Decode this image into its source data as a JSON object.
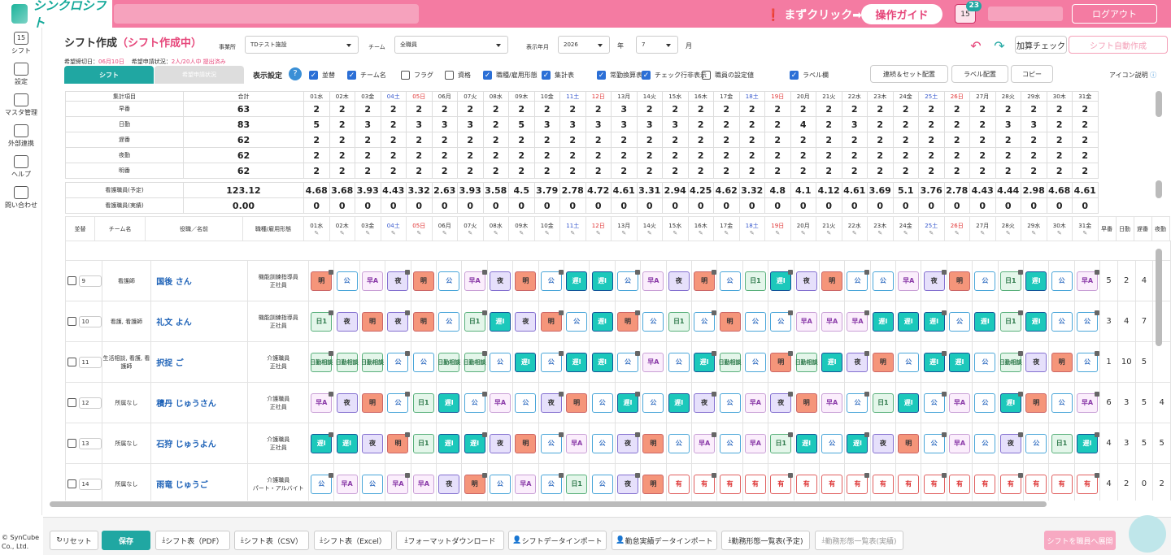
{
  "app": {
    "logo": "シンクロシフト",
    "first_click": "まずクリック➡",
    "guide": "操作ガイド",
    "cal_num": "15",
    "badge": "23",
    "logout": "ログアウト"
  },
  "sidebar": [
    {
      "label": "シフト",
      "icon": "calendar-icon"
    },
    {
      "label": "設定",
      "icon": "gear-icon"
    },
    {
      "label": "マスタ管理",
      "icon": "database-icon"
    },
    {
      "label": "外部連携",
      "icon": "cloud-icon"
    },
    {
      "label": "ヘルプ",
      "icon": "help-icon"
    },
    {
      "label": "問い合わせ",
      "icon": "mail-icon"
    }
  ],
  "copyright": "© SynCube Co., Ltd.",
  "page": {
    "title": "シフト作成",
    "status": "（シフト作成中）",
    "facility_lbl": "事業所",
    "facility": "TDテスト施設",
    "team_lbl": "チーム",
    "team": "全職員",
    "ym_lbl": "表示年月",
    "year": "2026",
    "year_unit": "年",
    "month": "7",
    "month_unit": "月",
    "deadline": "希望締切日：",
    "deadline_val": "06月10日",
    "req_status": "希望申請状況：",
    "req_val": "2人/20人中 提出済み",
    "btn_add": "加算チェック",
    "btn_auto": "シフト自動作成",
    "tab_shift": "シフト",
    "tab_req": "希望申請状況",
    "disp": "表示設定",
    "btn_chain": "連続＆セット配置",
    "btn_label": "ラベル配置",
    "btn_copy": "コピー",
    "icon_help": "アイコン説明"
  },
  "checks": [
    {
      "l": "並替",
      "on": true
    },
    {
      "l": "チーム名",
      "on": true
    },
    {
      "l": "フラグ",
      "on": false
    },
    {
      "l": "資格",
      "on": false
    },
    {
      "l": "職種/雇用形態",
      "on": true
    },
    {
      "l": "集計表",
      "on": true
    },
    {
      "l": "常勤換算表",
      "on": true
    },
    {
      "l": "チェック行非表示",
      "on": true
    },
    {
      "l": "職員の設定値",
      "on": false
    },
    {
      "l": "ラベル欄",
      "on": true
    }
  ],
  "days": [
    "01水",
    "02木",
    "03金",
    "04土",
    "05日",
    "06月",
    "07火",
    "08水",
    "09木",
    "10金",
    "11土",
    "12日",
    "13月",
    "14火",
    "15水",
    "16木",
    "17金",
    "18土",
    "19日",
    "20月",
    "21火",
    "22水",
    "23木",
    "24金",
    "25土",
    "26日",
    "27月",
    "28火",
    "29水",
    "30木",
    "31金"
  ],
  "summary": {
    "h1": "集計項目",
    "h2": "合計",
    "rows": [
      {
        "name": "早番",
        "total": "63",
        "v": [
          "2",
          "2",
          "2",
          "2",
          "2",
          "2",
          "2",
          "2",
          "2",
          "2",
          "2",
          "2",
          "3",
          "2",
          "2",
          "2",
          "2",
          "2",
          "2",
          "2",
          "2",
          "2",
          "2",
          "2",
          "2",
          "2",
          "2",
          "2",
          "2",
          "2",
          "2"
        ]
      },
      {
        "name": "日勤",
        "total": "83",
        "v": [
          "5",
          "2",
          "3",
          "2",
          "3",
          "3",
          "3",
          "2",
          "5",
          "3",
          "3",
          "3",
          "3",
          "3",
          "3",
          "2",
          "2",
          "2",
          "2",
          "4",
          "2",
          "3",
          "2",
          "2",
          "2",
          "2",
          "2",
          "3",
          "3",
          "2",
          "2"
        ]
      },
      {
        "name": "遅番",
        "total": "62",
        "v": [
          "2",
          "2",
          "2",
          "2",
          "2",
          "2",
          "2",
          "2",
          "2",
          "2",
          "2",
          "2",
          "2",
          "2",
          "2",
          "2",
          "2",
          "2",
          "2",
          "2",
          "2",
          "2",
          "2",
          "2",
          "2",
          "2",
          "2",
          "2",
          "2",
          "2",
          "2"
        ]
      },
      {
        "name": "夜勤",
        "total": "62",
        "v": [
          "2",
          "2",
          "2",
          "2",
          "2",
          "2",
          "2",
          "2",
          "2",
          "2",
          "2",
          "2",
          "2",
          "2",
          "2",
          "2",
          "2",
          "2",
          "2",
          "2",
          "2",
          "2",
          "2",
          "2",
          "2",
          "2",
          "2",
          "2",
          "2",
          "2",
          "2"
        ]
      },
      {
        "name": "明番",
        "total": "62",
        "v": [
          "2",
          "2",
          "2",
          "2",
          "2",
          "2",
          "2",
          "2",
          "2",
          "2",
          "2",
          "2",
          "2",
          "2",
          "2",
          "2",
          "2",
          "2",
          "2",
          "2",
          "2",
          "2",
          "2",
          "2",
          "2",
          "2",
          "2",
          "2",
          "2",
          "2",
          "2"
        ]
      }
    ],
    "fte": [
      {
        "name": "看護職員(予定)",
        "total": "123.12",
        "v": [
          "4.68",
          "3.68",
          "3.93",
          "4.43",
          "3.32",
          "2.63",
          "3.93",
          "3.58",
          "4.5",
          "3.79",
          "2.78",
          "4.72",
          "4.61",
          "3.31",
          "2.94",
          "4.25",
          "4.62",
          "3.32",
          "4.8",
          "4.1",
          "4.12",
          "4.61",
          "3.69",
          "5.1",
          "3.76",
          "2.78",
          "4.43",
          "4.44",
          "2.98",
          "4.68",
          "4.61"
        ]
      },
      {
        "name": "看護職員(実績)",
        "total": "0.00",
        "v": [
          "0",
          "0",
          "0",
          "0",
          "0",
          "0",
          "0",
          "0",
          "0",
          "0",
          "0",
          "0",
          "0",
          "0",
          "0",
          "0",
          "0",
          "0",
          "0",
          "0",
          "0",
          "0",
          "0",
          "0",
          "0",
          "0",
          "0",
          "0",
          "0",
          "0",
          "0"
        ]
      }
    ]
  },
  "grid_headers": {
    "sort": "並替",
    "team": "チーム名",
    "name": "役職／名前",
    "job": "職種/雇用形態",
    "tot": [
      "早番",
      "日勤",
      "遅番",
      "夜勤"
    ]
  },
  "staff": [
    {
      "no": "9",
      "team": "看護師",
      "name": "国後 さん",
      "job": "機能訓練指導員",
      "emp": "正社員",
      "s": [
        "明",
        "公",
        "早A",
        "夜",
        "明",
        "公",
        "早A",
        "夜",
        "明",
        "公",
        "遅I",
        "遅I",
        "公",
        "早A",
        "夜",
        "明",
        "公",
        "日1",
        "遅I",
        "夜",
        "明",
        "公",
        "公",
        "早A",
        "夜",
        "明",
        "公",
        "日1",
        "遅I",
        "公",
        "早A"
      ],
      "t": [
        "5",
        "2",
        "4",
        ""
      ]
    },
    {
      "no": "10",
      "team": "看護, 看護師",
      "name": "礼文 よん",
      "job": "機能訓練指導員",
      "emp": "正社員",
      "s": [
        "日1",
        "夜",
        "明",
        "夜",
        "明",
        "公",
        "日1",
        "遅I",
        "夜",
        "明",
        "公",
        "遅I",
        "明",
        "公",
        "日1",
        "公",
        "明",
        "公",
        "公",
        "早A",
        "早A",
        "早A",
        "遅I",
        "遅I",
        "遅I",
        "公",
        "遅I",
        "日1",
        "遅I",
        "公",
        "公"
      ],
      "t": [
        "3",
        "4",
        "7",
        ""
      ]
    },
    {
      "no": "11",
      "team": "生活相談, 看護, 看護師",
      "name": "択捉 ご",
      "job": "介護職員",
      "emp": "正社員",
      "s": [
        "日勤相談",
        "日勤相談",
        "日勤相談",
        "公",
        "公",
        "日勤相談",
        "日勤相談",
        "公",
        "遅I",
        "公",
        "遅I",
        "遅I",
        "公",
        "早A",
        "公",
        "遅I",
        "日勤相談",
        "公",
        "明",
        "日勤相談",
        "遅I",
        "夜",
        "明",
        "公",
        "遅I",
        "遅I",
        "公",
        "日勤相談",
        "夜",
        "明",
        "公"
      ],
      "t": [
        "1",
        "10",
        "5",
        ""
      ]
    },
    {
      "no": "12",
      "team": "所属なし",
      "name": "積丹 じゅうさん",
      "job": "介護職員",
      "emp": "正社員",
      "s": [
        "早A",
        "夜",
        "明",
        "公",
        "日1",
        "遅I",
        "公",
        "早A",
        "公",
        "夜",
        "明",
        "公",
        "遅I",
        "公",
        "遅I",
        "夜",
        "公",
        "早A",
        "夜",
        "明",
        "早A",
        "公",
        "日1",
        "遅I",
        "公",
        "早A",
        "公",
        "遅I",
        "明",
        "公",
        "早A"
      ],
      "t": [
        "6",
        "3",
        "5",
        "4"
      ]
    },
    {
      "no": "13",
      "team": "所属なし",
      "name": "石狩 じゅうよん",
      "job": "介護職員",
      "emp": "正社員",
      "s": [
        "遅I",
        "遅I",
        "夜",
        "明",
        "日1",
        "遅I",
        "遅I",
        "夜",
        "明",
        "公",
        "早A",
        "公",
        "夜",
        "明",
        "公",
        "早A",
        "公",
        "早A",
        "日1",
        "遅I",
        "公",
        "遅I",
        "夜",
        "明",
        "公",
        "早A",
        "公",
        "夜",
        "公",
        "日1",
        "遅I"
      ],
      "t": [
        "4",
        "3",
        "5",
        "5"
      ]
    },
    {
      "no": "14",
      "team": "所属なし",
      "name": "雨竜 じゅうご",
      "job": "介護職員",
      "emp": "パート・アルバイト",
      "s": [
        "公",
        "早A",
        "公",
        "早A",
        "早A",
        "夜",
        "明",
        "公",
        "早A",
        "公",
        "日1",
        "公",
        "夜",
        "明",
        "有",
        "有",
        "有",
        "有",
        "有",
        "有",
        "有",
        "有",
        "有",
        "有",
        "有",
        "有",
        "有",
        "有",
        "有",
        "有",
        "有"
      ],
      "t": [
        "4",
        "2",
        "0",
        "2"
      ]
    }
  ],
  "bottom": {
    "reset": "リセット",
    "save": "保存",
    "pdf": "シフト表（PDF）",
    "csv": "シフト表（CSV）",
    "excel": "シフト表（Excel）",
    "format": "フォーマットダウンロード",
    "import": "シフトデータインポート",
    "actual": "勤怠実績データインポート",
    "list_plan": "勤務形態一覧表(予定)",
    "list_actual": "勤務形態一覧表(実績)",
    "publish": "シフトを職員へ展開"
  }
}
